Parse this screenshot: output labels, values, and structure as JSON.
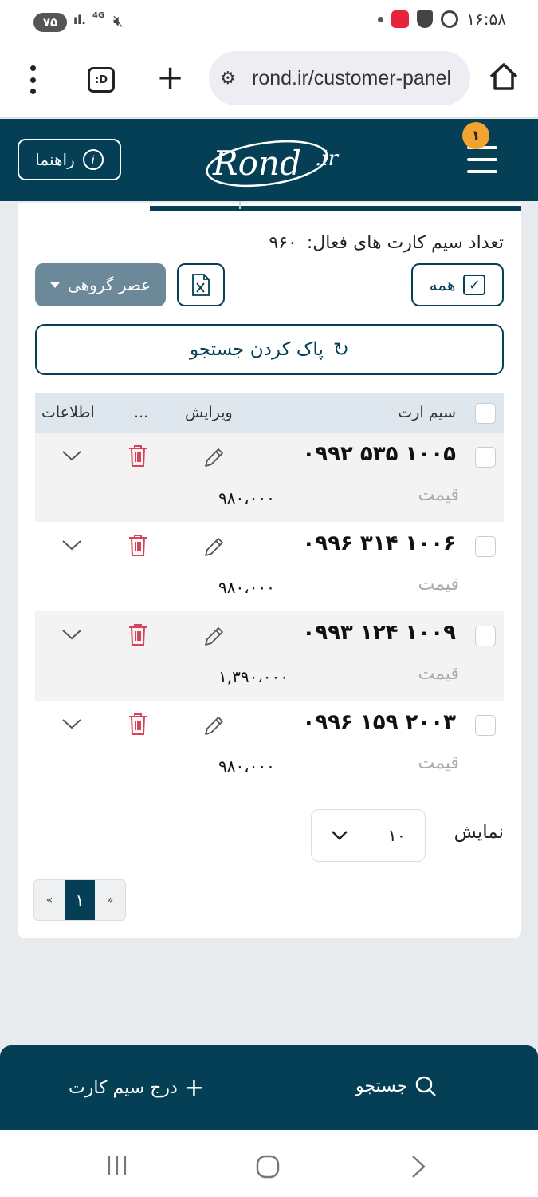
{
  "status_bar": {
    "battery": "۷۵",
    "network": "4G",
    "time": "۱۶:۵۸"
  },
  "browser": {
    "url": "rond.ir/customer-panel",
    "tab_label": ":D"
  },
  "header": {
    "guide_label": "راهنما",
    "logo_text": "Rond",
    "logo_suffix": ".ir",
    "notification_count": "۱"
  },
  "summary": {
    "active_label": "تعداد سیم کارت های فعال:",
    "active_count": "۹۶۰"
  },
  "toolbar": {
    "all_label": "همه",
    "group_label": "عصر گروهی",
    "clear_label": "پاک کردن جستجو"
  },
  "table": {
    "headers": {
      "sim": "سیم ارت",
      "edit": "ویرایش",
      "more": "...",
      "info": "اطلاعات"
    },
    "price_label": "قیمت",
    "rows": [
      {
        "number": "۰۹۹۲ ۵۳۵ ۱۰۰۵",
        "price": "۹۸۰،۰۰۰"
      },
      {
        "number": "۰۹۹۶ ۳۱۴ ۱۰۰۶",
        "price": "۹۸۰،۰۰۰"
      },
      {
        "number": "۰۹۹۳ ۱۲۴ ۱۰۰۹",
        "price": "۱,۳۹۰،۰۰۰"
      },
      {
        "number": "۰۹۹۶ ۱۵۹ ۲۰۰۳",
        "price": "۹۸۰،۰۰۰"
      }
    ]
  },
  "pagination": {
    "per_page_label": "نمایش",
    "per_page_value": "۱۰",
    "prev": "«",
    "current": "۱",
    "next": "»"
  },
  "bottom_nav": {
    "search_label": "جستجو",
    "add_label": "درج سیم کارت"
  },
  "colors": {
    "brand": "#043f55",
    "danger": "#d9435a",
    "accent": "#f0a330"
  }
}
